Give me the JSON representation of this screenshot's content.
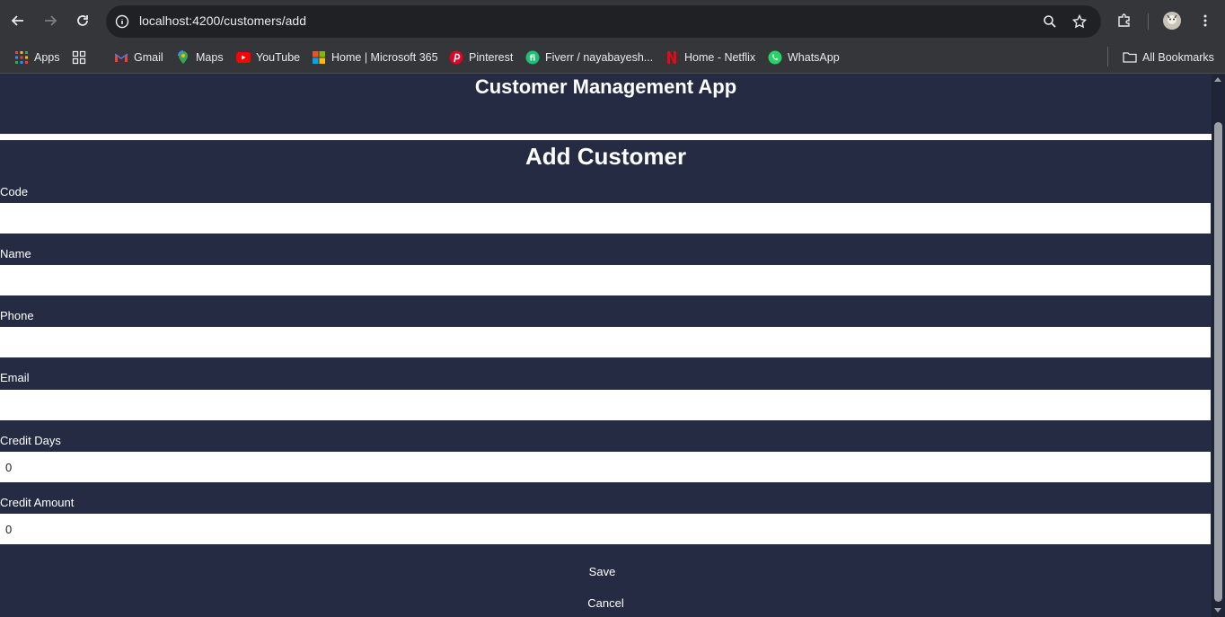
{
  "browser": {
    "url": "localhost:4200/customers/add",
    "bookmarks": [
      {
        "label": "Apps",
        "icon": "apps-grid-icon"
      },
      {
        "label": "",
        "icon": "tab-groups-icon"
      },
      {
        "label": "Gmail",
        "icon": "gmail-icon"
      },
      {
        "label": "Maps",
        "icon": "maps-icon"
      },
      {
        "label": "YouTube",
        "icon": "youtube-icon"
      },
      {
        "label": "Home | Microsoft 365",
        "icon": "microsoft-icon"
      },
      {
        "label": "Pinterest",
        "icon": "pinterest-icon"
      },
      {
        "label": "Fiverr / nayabayesh...",
        "icon": "fiverr-icon"
      },
      {
        "label": "Home - Netflix",
        "icon": "netflix-icon"
      },
      {
        "label": "WhatsApp",
        "icon": "whatsapp-icon"
      }
    ],
    "all_bookmarks": "All Bookmarks"
  },
  "app": {
    "title": "Customer Management App"
  },
  "form": {
    "title": "Add Customer",
    "fields": [
      {
        "label": "Code",
        "value": ""
      },
      {
        "label": "Name",
        "value": ""
      },
      {
        "label": "Phone",
        "value": ""
      },
      {
        "label": "Email",
        "value": ""
      },
      {
        "label": "Credit Days",
        "value": "0"
      },
      {
        "label": "Credit Amount",
        "value": "0"
      }
    ],
    "save_label": "Save",
    "cancel_label": "Cancel"
  },
  "colors": {
    "page_bg": "#242b42",
    "chrome_bg": "#35363a",
    "omnibox_bg": "#202124",
    "text": "#ffffff"
  }
}
